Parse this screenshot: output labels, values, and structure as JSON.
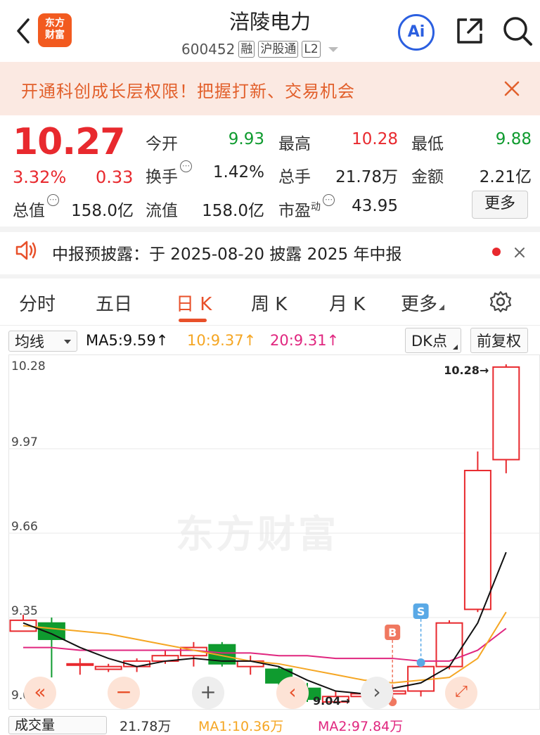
{
  "header": {
    "title": "涪陵电力",
    "code": "600452",
    "tags": [
      "融",
      "沪股通",
      "L2"
    ],
    "logo_text": [
      "东方",
      "财富"
    ],
    "ai_label": "Ai"
  },
  "banner": {
    "text": "开通科创成长层权限！把握打新、交易机会"
  },
  "quote": {
    "price": "10.27",
    "change_pct": "3.32%",
    "change": "0.33",
    "rows": [
      [
        {
          "label": "今开",
          "value": "9.93",
          "color": "green"
        },
        {
          "label": "最高",
          "value": "10.28",
          "color": "red"
        },
        {
          "label": "最低",
          "value": "9.88",
          "color": "green"
        }
      ],
      [
        {
          "label": "换手",
          "value": "1.42%",
          "color": "dark",
          "info": true
        },
        {
          "label": "总手",
          "value": "21.78万",
          "color": "dark"
        },
        {
          "label": "金额",
          "value": "2.21亿",
          "color": "dark"
        }
      ],
      [
        {
          "label": "流值",
          "value": "158.0亿",
          "color": "dark"
        },
        {
          "label": "市盈",
          "sup": "动",
          "value": "43.95",
          "color": "dark",
          "info": true
        }
      ]
    ],
    "total_value_label": "总值",
    "total_value": "158.0亿",
    "more_label": "更多"
  },
  "notice": {
    "text": "中报预披露：于 2025-08-20 披露 2025 年中报"
  },
  "tabs": [
    "分时",
    "五日",
    "日 K",
    "周 K",
    "月 K",
    "更多"
  ],
  "active_tab": 2,
  "toolbar": {
    "ma_dropdown": "均线",
    "ma5": "MA5:9.59",
    "ma10": "10:9.37",
    "ma20": "20:9.31",
    "dk_label": "DK点",
    "adjust_label": "前复权"
  },
  "colors": {
    "up": "#e8292e",
    "down": "#0f9b2f",
    "ma5": "#111111",
    "ma10": "#f5a623",
    "ma20": "#e0267f",
    "accent": "#e8502a"
  },
  "chart_data": {
    "type": "candlestick",
    "y_ticks": [
      "10.28",
      "9.97",
      "9.66",
      "9.35",
      "9.04"
    ],
    "ylim": [
      9.04,
      10.28
    ],
    "candles": [
      {
        "o": 9.3,
        "c": 9.34,
        "h": 9.36,
        "l": 9.3
      },
      {
        "o": 9.33,
        "c": 9.27,
        "h": 9.35,
        "l": 9.13
      },
      {
        "o": 9.18,
        "c": 9.18,
        "h": 9.2,
        "l": 9.14
      },
      {
        "o": 9.16,
        "c": 9.17,
        "h": 9.18,
        "l": 9.15
      },
      {
        "o": 9.17,
        "c": 9.19,
        "h": 9.2,
        "l": 9.15
      },
      {
        "o": 9.19,
        "c": 9.21,
        "h": 9.23,
        "l": 9.18
      },
      {
        "o": 9.21,
        "c": 9.24,
        "h": 9.26,
        "l": 9.17
      },
      {
        "o": 9.25,
        "c": 9.18,
        "h": 9.26,
        "l": 9.17
      },
      {
        "o": 9.17,
        "c": 9.19,
        "h": 9.21,
        "l": 9.14
      },
      {
        "o": 9.16,
        "c": 9.11,
        "h": 9.17,
        "l": 9.1
      },
      {
        "o": 9.09,
        "c": 9.05,
        "h": 9.11,
        "l": 9.04
      },
      {
        "o": 9.04,
        "c": 9.06,
        "h": 9.08,
        "l": 9.04
      },
      {
        "o": 9.06,
        "c": 9.07,
        "h": 9.09,
        "l": 9.05
      },
      {
        "o": 9.07,
        "c": 9.08,
        "h": 9.1,
        "l": 9.04
      },
      {
        "o": 9.08,
        "c": 9.17,
        "h": 9.17,
        "l": 9.06
      },
      {
        "o": 9.17,
        "c": 9.33,
        "h": 9.34,
        "l": 9.16
      },
      {
        "o": 9.38,
        "c": 9.89,
        "h": 9.96,
        "l": 9.37
      },
      {
        "o": 9.93,
        "c": 10.27,
        "h": 10.28,
        "l": 9.88
      }
    ],
    "ma5": [
      9.33,
      9.29,
      9.24,
      9.2,
      9.17,
      9.19,
      9.2,
      9.19,
      9.19,
      9.17,
      9.12,
      9.08,
      9.07,
      9.09,
      9.11,
      9.17,
      9.33,
      9.59
    ],
    "ma10": [
      9.32,
      9.31,
      9.3,
      9.29,
      9.27,
      9.25,
      9.23,
      9.21,
      9.19,
      9.18,
      9.16,
      9.14,
      9.12,
      9.11,
      9.12,
      9.13,
      9.2,
      9.37
    ],
    "ma20": [
      9.24,
      9.24,
      9.23,
      9.23,
      9.23,
      9.23,
      9.23,
      9.22,
      9.22,
      9.21,
      9.21,
      9.2,
      9.2,
      9.2,
      9.19,
      9.19,
      9.23,
      9.31
    ],
    "high_label": "10.28",
    "low_label": "9.04",
    "signals": [
      {
        "index": 13,
        "type": "B"
      },
      {
        "index": 14,
        "type": "S"
      }
    ],
    "watermark": "东方财富"
  },
  "volume_bar": {
    "label": "成交量",
    "value": "21.78万",
    "ma1": "MA1:10.36万",
    "ma2": "MA2:97.84万"
  }
}
